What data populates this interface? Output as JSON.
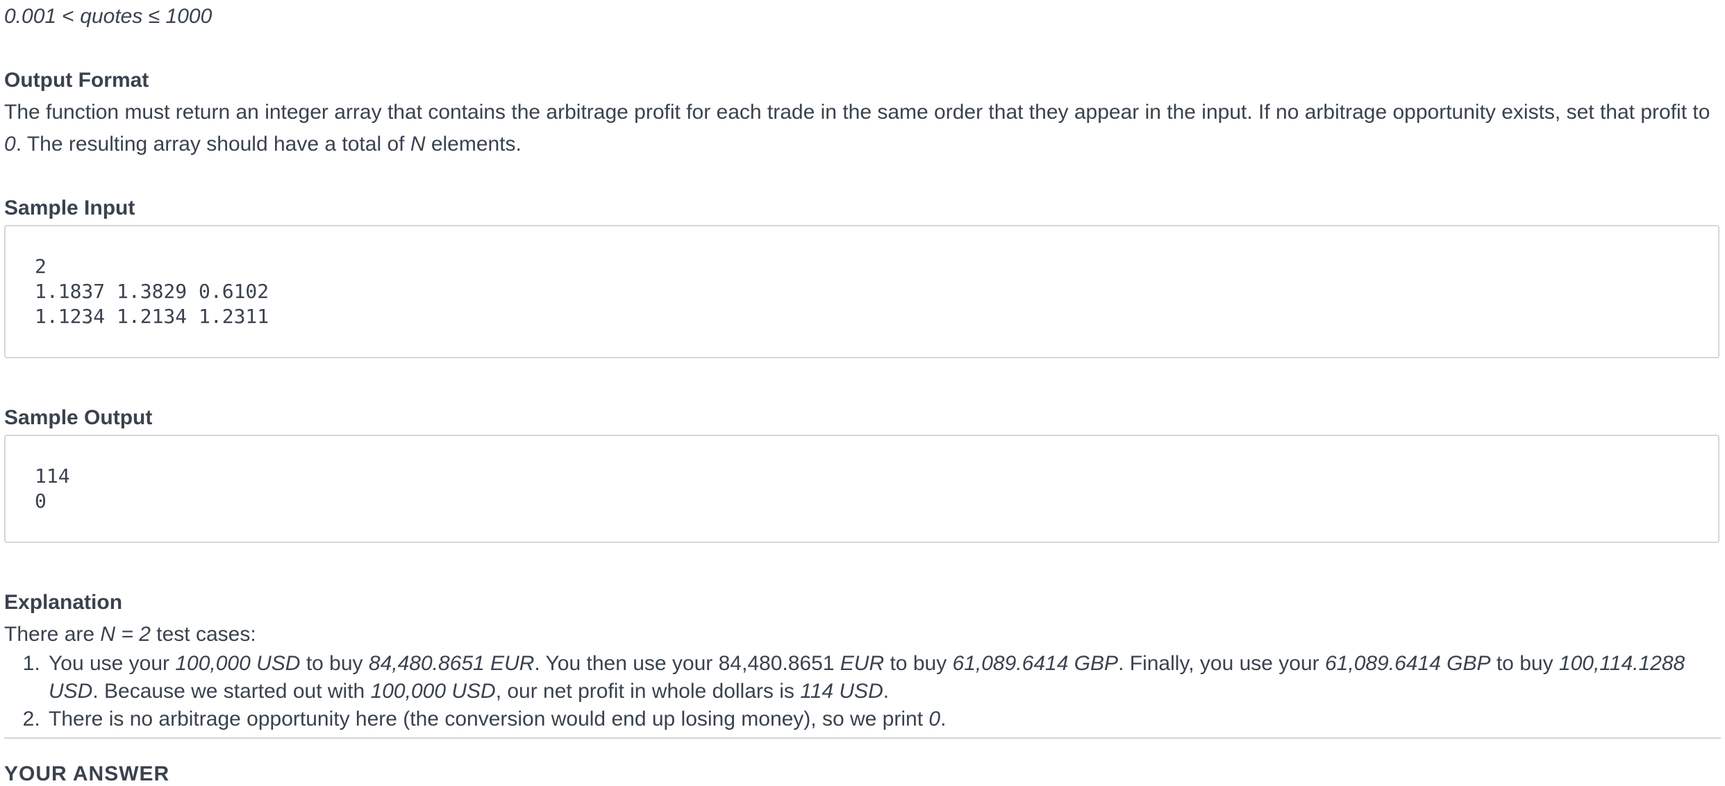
{
  "constraint": {
    "left": "0.001",
    "op1": "<",
    "var": "quotes",
    "op2": "≤",
    "right": "1000"
  },
  "output_format": {
    "heading": "Output Format",
    "text_1": "The function must return an integer array that contains the arbitrage profit for each trade in the same order that they appear in the input. If no arbitrage opportunity exists, set that profit to ",
    "zero": "0",
    "text_2": ". The resulting array should have a total of ",
    "n": "N",
    "text_3": " elements."
  },
  "sample_input": {
    "heading": "Sample Input",
    "lines": [
      "2",
      "1.1837 1.3829 0.6102",
      "1.1234 1.2134 1.2311"
    ]
  },
  "sample_output": {
    "heading": "Sample Output",
    "lines": [
      "114",
      "0"
    ]
  },
  "explanation": {
    "heading": "Explanation",
    "intro_1": "There are ",
    "intro_n": "N = 2",
    "intro_2": " test cases:",
    "item1": {
      "t1": "You use your ",
      "i1": "100,000 USD",
      "t2": " to buy ",
      "i2": "84,480.8651 EUR",
      "t3": ". You then use your 84,480.8651 ",
      "i3": "EUR",
      "t4": " to buy ",
      "i4": "61,089.6414 GBP",
      "t5": ". Finally, you use your ",
      "i5": "61,089.6414 GBP",
      "t6": " to buy ",
      "i6": "100,114.1288 USD",
      "t7": ". Because we started out with ",
      "i7": "100,000 USD",
      "t8": ", our net profit in whole dollars is ",
      "i8": "114 USD",
      "t9": "."
    },
    "item2": {
      "t1": "There is no arbitrage opportunity here (the conversion would end up losing money), so we print ",
      "i1": "0",
      "t2": "."
    }
  },
  "your_answer": {
    "heading": "YOUR ANSWER"
  }
}
